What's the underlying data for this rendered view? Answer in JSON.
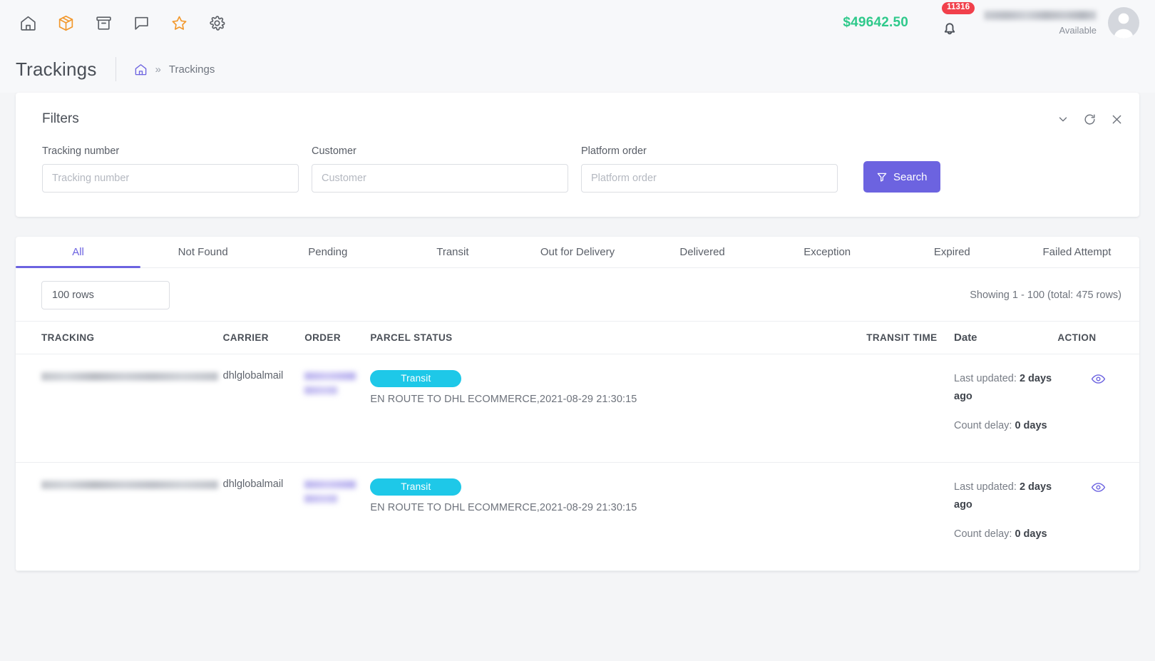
{
  "topbar": {
    "icons": [
      {
        "name": "home-icon",
        "label": "Home",
        "color": "#5c6066"
      },
      {
        "name": "package-icon",
        "label": "Parcels",
        "color": "#f2982c"
      },
      {
        "name": "archive-icon",
        "label": "Archive",
        "color": "#5c6066"
      },
      {
        "name": "chat-icon",
        "label": "Messages",
        "color": "#5c6066"
      },
      {
        "name": "star-icon",
        "label": "Favorites",
        "color": "#f2982c"
      },
      {
        "name": "gear-icon",
        "label": "Settings",
        "color": "#5c6066"
      }
    ],
    "balance": "$49642.50",
    "balance_color": "#2fc98b",
    "notification_count": "11316",
    "notification_badge_color": "#f1404b",
    "user_status": "Available"
  },
  "page": {
    "title": "Trackings",
    "breadcrumb": {
      "home_icon": "home-icon",
      "separator": "»",
      "current": "Trackings"
    }
  },
  "filters": {
    "title": "Filters",
    "actions": [
      {
        "name": "collapse-icon",
        "label": "Collapse"
      },
      {
        "name": "refresh-icon",
        "label": "Refresh"
      },
      {
        "name": "close-icon",
        "label": "Close"
      }
    ],
    "fields": [
      {
        "label": "Tracking number",
        "placeholder": "Tracking number",
        "value": ""
      },
      {
        "label": "Customer",
        "placeholder": "Customer",
        "value": ""
      },
      {
        "label": "Platform order",
        "placeholder": "Platform order",
        "value": ""
      }
    ],
    "search_button": {
      "label": "Search",
      "icon": "filter-funnel-icon",
      "color": "#6c63e0"
    }
  },
  "tabs": [
    {
      "label": "All",
      "active": true
    },
    {
      "label": "Not Found",
      "active": false
    },
    {
      "label": "Pending",
      "active": false
    },
    {
      "label": "Transit",
      "active": false
    },
    {
      "label": "Out for Delivery",
      "active": false
    },
    {
      "label": "Delivered",
      "active": false
    },
    {
      "label": "Exception",
      "active": false
    },
    {
      "label": "Expired",
      "active": false
    },
    {
      "label": "Failed Attempt",
      "active": false
    }
  ],
  "table": {
    "rows_select": "100 rows",
    "showing": "Showing 1 - 100 (total: 475 rows)",
    "headers": {
      "tracking": "TRACKING",
      "carrier": "CARRIER",
      "order": "ORDER",
      "status": "PARCEL STATUS",
      "transit": "TRANSIT TIME",
      "date": "Date",
      "action": "ACTION"
    },
    "rows": [
      {
        "tracking": "",
        "carrier": "dhlglobalmail",
        "order": "",
        "status_badge": "Transit",
        "status_badge_color": "#1ec8e8",
        "status_detail": "EN ROUTE TO DHL ECOMMERCE,2021-08-29 21:30:15",
        "transit_time": "",
        "last_updated_label": "Last updated:",
        "last_updated_value": "2 days ago",
        "count_delay_label": "Count delay:",
        "count_delay_value": "0 days",
        "action_icon": "eye-icon"
      },
      {
        "tracking": "",
        "carrier": "dhlglobalmail",
        "order": "",
        "status_badge": "Transit",
        "status_badge_color": "#1ec8e8",
        "status_detail": "EN ROUTE TO DHL ECOMMERCE,2021-08-29 21:30:15",
        "transit_time": "",
        "last_updated_label": "Last updated:",
        "last_updated_value": "2 days ago",
        "count_delay_label": "Count delay:",
        "count_delay_value": "0 days",
        "action_icon": "eye-icon"
      }
    ]
  }
}
